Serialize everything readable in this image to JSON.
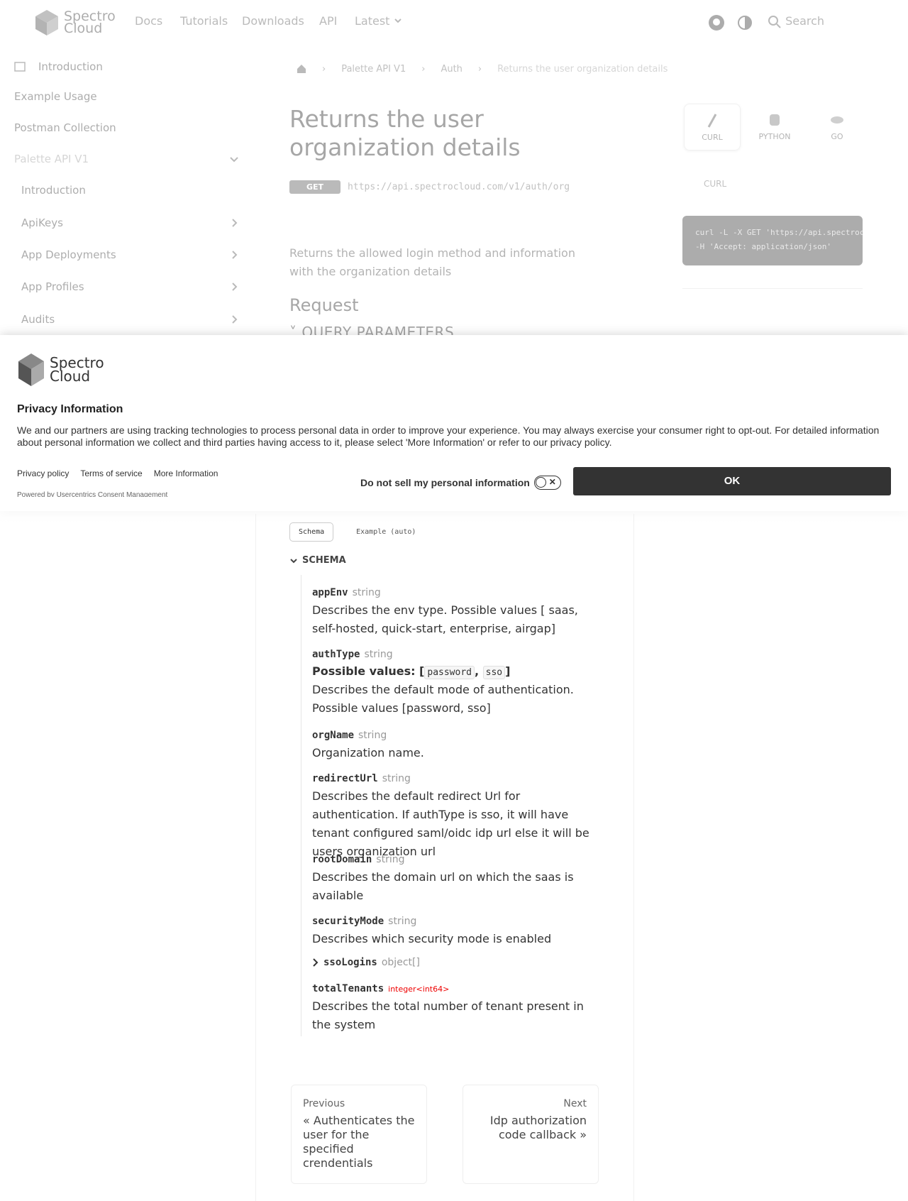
{
  "brand": {
    "name_line1": "Spectro",
    "name_line2": "Cloud"
  },
  "navbar": {
    "links": [
      "Docs",
      "Tutorials",
      "Downloads",
      "API",
      "Latest"
    ],
    "search_label": "Search"
  },
  "sidebar": {
    "items": [
      {
        "label": "Introduction"
      },
      {
        "label": "Example Usage"
      },
      {
        "label": "Postman Collection"
      },
      {
        "label": "Palette API V1"
      },
      {
        "label": "Introduction"
      },
      {
        "label": "ApiKeys"
      },
      {
        "label": "App Deployments"
      },
      {
        "label": "App Profiles"
      },
      {
        "label": "Audits"
      }
    ]
  },
  "breadcrumbs": [
    "Palette API V1",
    "Auth",
    "Returns the user organization details"
  ],
  "page": {
    "title": "Returns the user organization details",
    "method": "GET",
    "url": "https://api.spectrocloud.com/v1/auth/org",
    "description": "Returns the allowed login method and information with the organization details",
    "request_heading": "Request",
    "query_params_heading": "QUERY PARAMETERS"
  },
  "code_panel": {
    "tabs": [
      "CURL",
      "PYTHON",
      "GO"
    ],
    "curl_label": "CURL",
    "lines": [
      "curl -L -X GET 'https://api.spectroc",
      "  -H 'Accept: application/json'"
    ]
  },
  "consent": {
    "logo_line1": "Spectro",
    "logo_line2": "Cloud",
    "title": "Privacy Information",
    "text": "We and our partners are using tracking technologies to process personal data in order to improve your experience. You may always exercise your consumer right to opt-out. For detailed information about personal information we collect and third parties having access to it, please select 'More Information' or refer to our privacy policy.",
    "links": [
      "Privacy policy",
      "Terms of service",
      "More Information"
    ],
    "powered_by": "Powered by Usercentrics Consent Management",
    "do_not_sell": "Do not sell my personal information",
    "ok_label": "OK"
  },
  "response": {
    "tabs": [
      "Schema",
      "Example (auto)"
    ],
    "schema_label": "SCHEMA",
    "properties": [
      {
        "name": "appEnv",
        "type": "string",
        "desc": "Describes the env type. Possible values [ saas, self-hosted, quick-start, enterprise, airgap]"
      },
      {
        "name": "authType",
        "type": "string",
        "possible_label": "Possible values:",
        "values": [
          "password",
          "sso"
        ],
        "desc": "Describes the default mode of authentication. Possible values [password, sso]"
      },
      {
        "name": "orgName",
        "type": "string",
        "desc": "Organization name."
      },
      {
        "name": "redirectUrl",
        "type": "string",
        "desc": "Describes the default redirect Url for authentication. If authType is sso, it will have tenant configured saml/oidc idp url else it will be users organization url"
      },
      {
        "name": "rootDomain",
        "type": "string",
        "desc": "Describes the domain url on which the saas is available"
      },
      {
        "name": "securityMode",
        "type": "string",
        "desc": "Describes which security mode is enabled"
      },
      {
        "name": "ssoLogins",
        "type": "object[]"
      },
      {
        "name": "totalTenants",
        "type": "integer",
        "format": "<int64>",
        "desc": "Describes the total number of tenant present in the system"
      }
    ]
  },
  "pagination": {
    "prev_label": "Previous",
    "prev_title": "« Authenticates the user for the specified crendentials",
    "next_label": "Next",
    "next_title": "Idp authorization code callback »"
  }
}
